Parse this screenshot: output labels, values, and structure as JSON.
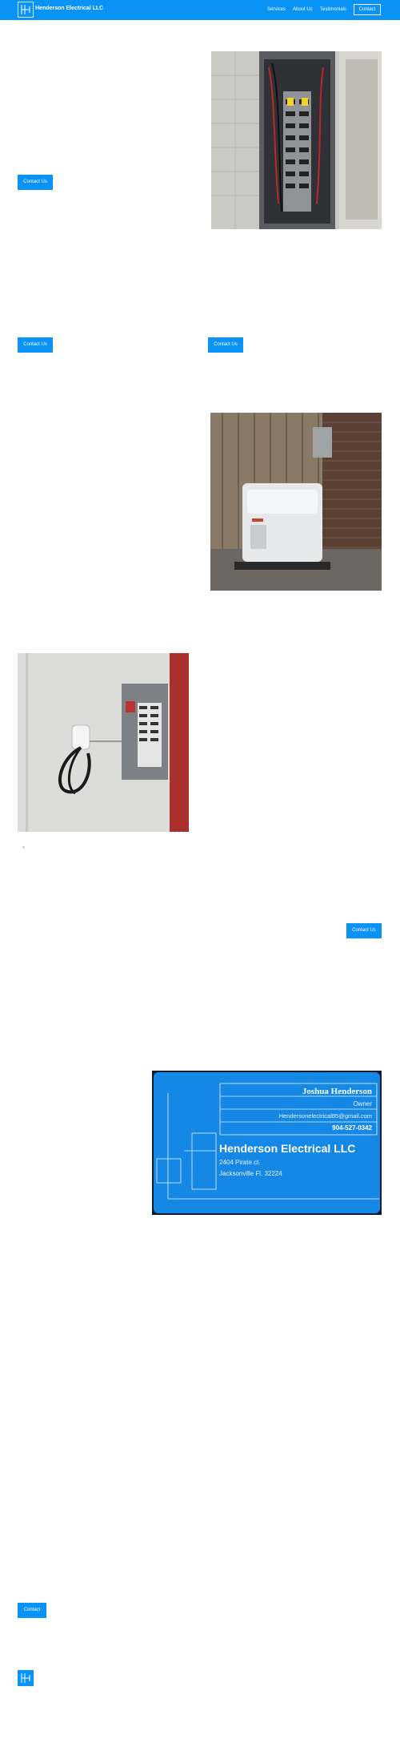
{
  "header": {
    "brand": "Henderson Electrical LLC",
    "nav": [
      "Services",
      "About Us",
      "Testimonials"
    ],
    "contact_button": "Contact"
  },
  "sections": {
    "contact_label": "Contact Us",
    "contact_short": "Contact"
  },
  "business_card": {
    "name": "Joshua Henderson",
    "title": "Owner",
    "email": "Hendersonelectrical85@gmail.com",
    "phone": "904-527-0342",
    "company": "Henderson Electrical LLC",
    "street": "2404 Pirate ct.",
    "city": "Jacksonville Fl. 32224"
  },
  "colors": {
    "brand_blue": "#0a93f6",
    "card_blue": "#1588e6"
  }
}
